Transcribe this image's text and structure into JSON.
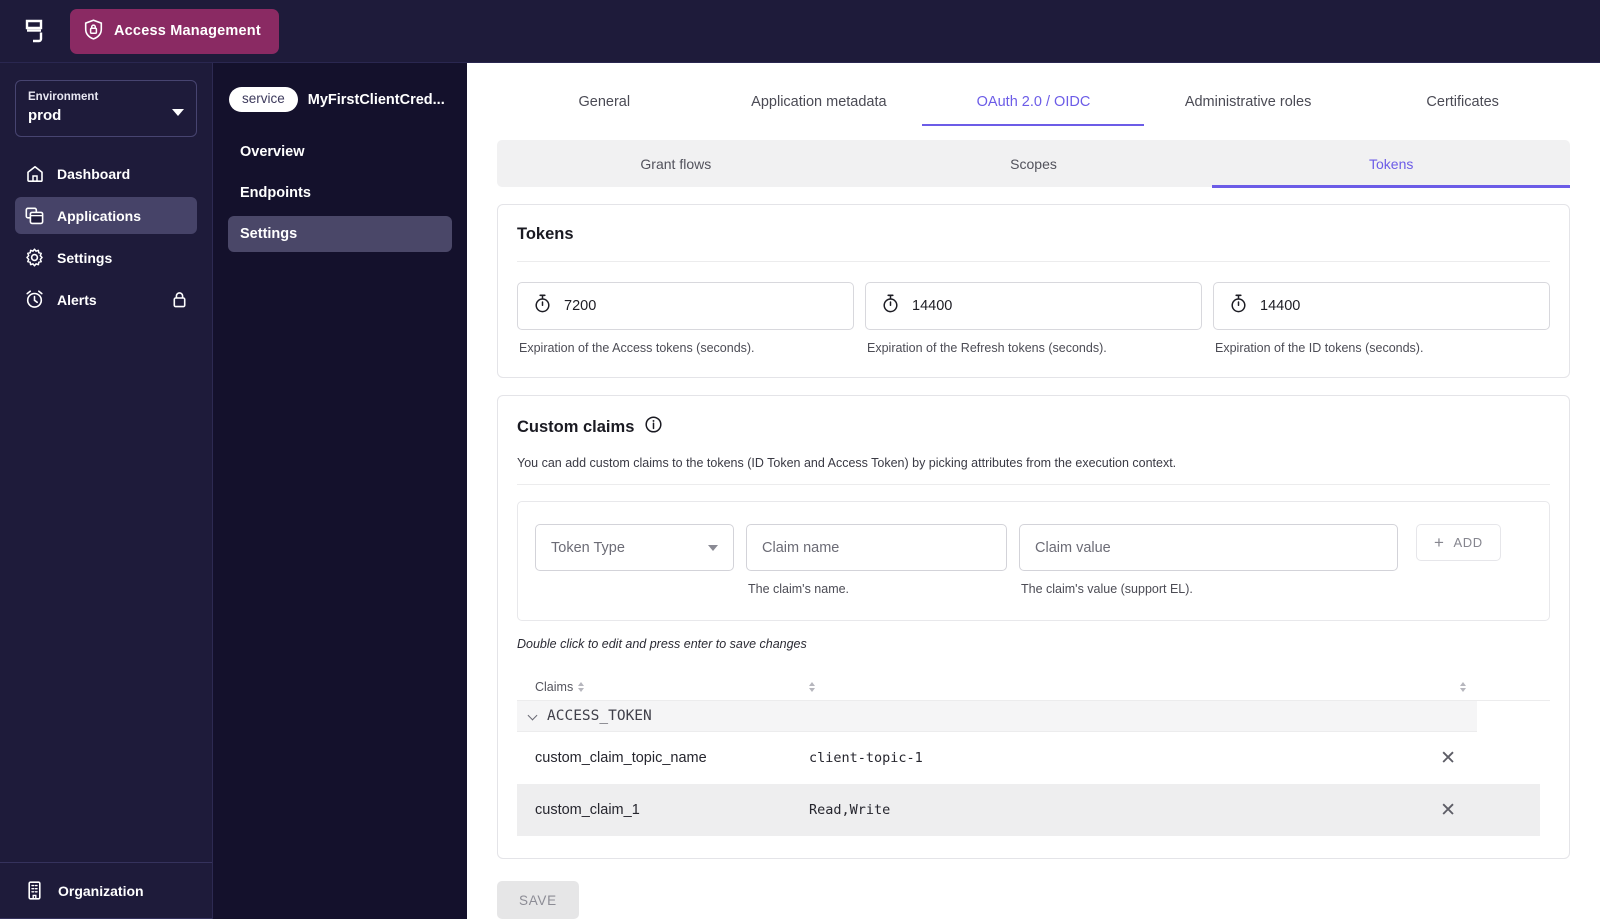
{
  "topbar": {
    "logo_name": "gravitee-logo",
    "brand_label": "Access Management",
    "brand_color": "#8a2a63"
  },
  "sidebar": {
    "environment": {
      "label": "Environment",
      "value": "prod"
    },
    "items": [
      {
        "label": "Dashboard",
        "icon": "home-icon",
        "active": false,
        "locked": false
      },
      {
        "label": "Applications",
        "icon": "applications-icon",
        "active": true,
        "locked": false
      },
      {
        "label": "Settings",
        "icon": "gear-icon",
        "active": false,
        "locked": false
      },
      {
        "label": "Alerts",
        "icon": "alarm-clock-icon",
        "active": false,
        "locked": true
      }
    ],
    "footer": {
      "label": "Organization",
      "icon": "building-icon"
    }
  },
  "subnav": {
    "chip": "service",
    "app_title": "MyFirstClientCred...",
    "items": [
      {
        "label": "Overview",
        "active": false
      },
      {
        "label": "Endpoints",
        "active": false
      },
      {
        "label": "Settings",
        "active": true
      }
    ]
  },
  "tabs": [
    {
      "label": "General",
      "active": false
    },
    {
      "label": "Application metadata",
      "active": false
    },
    {
      "label": "OAuth 2.0 / OIDC",
      "active": true
    },
    {
      "label": "Administrative roles",
      "active": false
    },
    {
      "label": "Certificates",
      "active": false
    }
  ],
  "subtabs": [
    {
      "label": "Grant flows",
      "active": false
    },
    {
      "label": "Scopes",
      "active": false
    },
    {
      "label": "Tokens",
      "active": true
    }
  ],
  "tokens_card": {
    "title": "Tokens",
    "fields": [
      {
        "icon": "stopwatch-icon",
        "value": "7200",
        "hint": "Expiration of the Access tokens (seconds)."
      },
      {
        "icon": "stopwatch-icon",
        "value": "14400",
        "hint": "Expiration of the Refresh tokens (seconds)."
      },
      {
        "icon": "stopwatch-icon",
        "value": "14400",
        "hint": "Expiration of the ID tokens (seconds)."
      }
    ]
  },
  "claims_card": {
    "title": "Custom claims",
    "info_icon": "info-icon",
    "description": "You can add custom claims to the tokens (ID Token and Access Token) by picking attributes from the execution context.",
    "form": {
      "token_type_placeholder": "Token Type",
      "claim_name_placeholder": "Claim name",
      "claim_name_hint": "The claim's name.",
      "claim_value_placeholder": "Claim value",
      "claim_value_hint": "The claim's value (support EL).",
      "add_label": "ADD"
    },
    "edit_note": "Double click to edit and press enter to save changes",
    "table": {
      "header": {
        "claims": "Claims"
      },
      "group": "ACCESS_TOKEN",
      "rows": [
        {
          "name": "custom_claim_topic_name",
          "value": "client-topic-1"
        },
        {
          "name": "custom_claim_1",
          "value": "Read,Write"
        }
      ]
    }
  },
  "footer": {
    "save_label": "SAVE"
  },
  "colors": {
    "accent": "#6c5ce7",
    "sidebar_bg": "#1e1b3a",
    "subnav_bg": "#14112c",
    "brand_badge": "#8a2a63"
  }
}
